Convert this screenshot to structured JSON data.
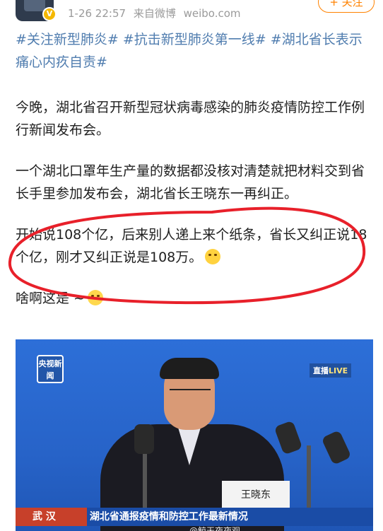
{
  "header": {
    "timestamp": "1-26 22:57",
    "source_label": "来自微博",
    "source_site": "weibo.com",
    "follow_label": "+ 关注"
  },
  "post": {
    "hashtags": [
      "#关注新型肺炎#",
      "#抗击新型肺炎第一线#",
      "#湖北省长表示痛心内疚自责#"
    ],
    "paragraphs": [
      "今晚，湖北省召开新型冠状病毒感染的肺炎疫情防控工作例行新闻发布会。",
      "一个湖北口罩年生产量的数据都没核对清楚就把材料交到省长手里参加发布会，湖北省长王晓东一再纠正。",
      "开始说108个亿，后来别人递上来个纸条，省长又纠正说18个亿，刚才又纠正说是108万。",
      "啥啊这是 ~"
    ],
    "emoji_names": [
      "laughing-crying-emoji",
      "sweat-emoji"
    ]
  },
  "video": {
    "channel_logo": "央视新闻",
    "live_label_prefix": "直播",
    "live_label": "LIVE",
    "nameplate": "王晓东",
    "ticker_location": "武 汉",
    "ticker_title": "湖北省通报疫情和防控工作最新情况",
    "watermark": "@鲸天夜夜观"
  },
  "colors": {
    "hashtag": "#507daf",
    "highlight_circle": "#e8202a",
    "follow": "#ff8200",
    "video_bg": "#2763c8"
  }
}
